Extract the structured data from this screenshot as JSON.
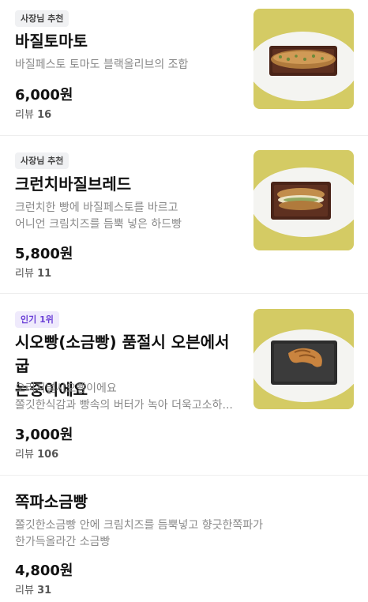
{
  "colors": {
    "owner_badge_bg": "#f0f1f3",
    "popular_badge_bg": "#efeafc",
    "popular_badge_text": "#6a3fd6",
    "thumb_background": "#d8cf6a"
  },
  "menu_items": [
    {
      "badge": "사장님 추천",
      "title_lines": [
        "바질토마토"
      ],
      "description_lines": [
        "바질페스토 토마도 블랙올리브의 조합"
      ],
      "price": "6,000원",
      "review_label": "리뷰",
      "review_count": "16",
      "thumb_icon": "bread-baguette-photo"
    },
    {
      "badge": "사장님 추천",
      "title_lines": [
        "크런치바질브레드"
      ],
      "description_lines": [
        "크런치한 빵에 바질페스토를 바르고",
        "어니언 크림치즈를 듬뿍 넣은 하드빵"
      ],
      "price": "5,800원",
      "review_label": "리뷰",
      "review_count": "11",
      "thumb_icon": "bread-sandwich-photo"
    },
    {
      "badge": "인기 1위",
      "title_lines": [
        "시오빵(소금빵) 품절시 오븐에서 굽",
        "는중이에요"
      ],
      "description_lines": [
        "오리지널시오빵이에요",
        "쫄깃한식감과 빵속의 버터가 녹아 더욱고소하..."
      ],
      "price": "3,000원",
      "review_label": "리뷰",
      "review_count": "106",
      "thumb_icon": "croissant-photo"
    },
    {
      "badge": "",
      "title_lines": [
        "쪽파소금빵"
      ],
      "description_lines": [
        "쫄깃한소금빵 안에 크림치즈를 듬뿍넣고 향긋한쪽파가",
        "한가득올라간 소금빵"
      ],
      "price": "4,800원",
      "review_label": "리뷰",
      "review_count": "31",
      "thumb_icon": ""
    }
  ]
}
